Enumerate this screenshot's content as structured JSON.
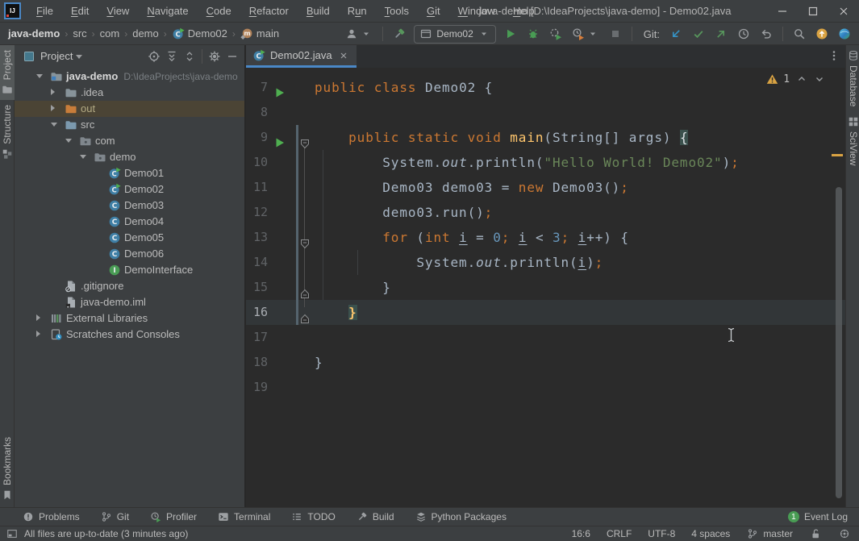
{
  "window": {
    "title": "java-demo [D:\\IdeaProjects\\java-demo] - Demo02.java",
    "menus": [
      {
        "label": "File",
        "mnemonic": 0
      },
      {
        "label": "Edit",
        "mnemonic": 0
      },
      {
        "label": "View",
        "mnemonic": 0
      },
      {
        "label": "Navigate",
        "mnemonic": 0
      },
      {
        "label": "Code",
        "mnemonic": 0
      },
      {
        "label": "Refactor",
        "mnemonic": 0
      },
      {
        "label": "Build",
        "mnemonic": 0
      },
      {
        "label": "Run",
        "mnemonic": 1
      },
      {
        "label": "Tools",
        "mnemonic": 0
      },
      {
        "label": "Git",
        "mnemonic": 0
      },
      {
        "label": "Window",
        "mnemonic": 0
      },
      {
        "label": "Help",
        "mnemonic": 0
      }
    ]
  },
  "navbar": {
    "breadcrumbs": [
      {
        "label": "java-demo",
        "bold": true
      },
      {
        "label": "src"
      },
      {
        "label": "com"
      },
      {
        "label": "demo"
      },
      {
        "label": "Demo02",
        "icon": "class-run-icon"
      },
      {
        "label": "main",
        "icon": "method-icon"
      }
    ],
    "toolbar": {
      "run_config": "Demo02",
      "git_label": "Git:",
      "left_icons": [
        "user-icon",
        "build-hammer-icon"
      ],
      "run_icons": [
        "run-icon",
        "debug-icon",
        "coverage-icon",
        "profiler-run-icon",
        "stop-icon"
      ],
      "git_icons": [
        "update-project-icon",
        "commit-icon",
        "push-icon",
        "history-icon",
        "rollback-icon"
      ],
      "right_icons": [
        "search-everywhere-icon",
        "updates-icon",
        "toolbox-icon"
      ]
    }
  },
  "left_stripe": {
    "top": [
      {
        "label": "Project",
        "icon": "project-tab-icon",
        "active": true
      },
      {
        "label": "Structure",
        "icon": "structure-tab-icon",
        "active": false
      }
    ],
    "bottom": [
      {
        "label": "Bookmarks",
        "icon": "bookmarks-tab-icon",
        "active": false
      }
    ]
  },
  "right_stripe": [
    {
      "label": "Database",
      "icon": "database-tab-icon"
    },
    {
      "label": "SciView",
      "icon": "grid-tab-icon"
    }
  ],
  "project": {
    "header": {
      "title": "Project",
      "icons": [
        "locate-icon",
        "expand-all-icon",
        "collapse-all-icon",
        "settings-icon",
        "hide-icon"
      ]
    },
    "tree": [
      {
        "label": "java-demo",
        "suffix": "D:\\IdeaProjects\\java-demo",
        "icon": "project-folder-icon",
        "depth": 0,
        "chevron": "down",
        "bold": true
      },
      {
        "label": ".idea",
        "icon": "folder-icon",
        "depth": 1,
        "chevron": "right"
      },
      {
        "label": "out",
        "icon": "folder-excluded-icon",
        "depth": 1,
        "chevron": "right",
        "selected": true
      },
      {
        "label": "src",
        "icon": "folder-src-icon",
        "depth": 1,
        "chevron": "down"
      },
      {
        "label": "com",
        "icon": "package-icon",
        "depth": 2,
        "chevron": "down"
      },
      {
        "label": "demo",
        "icon": "package-icon",
        "depth": 3,
        "chevron": "down"
      },
      {
        "label": "Demo01",
        "icon": "class-run-icon",
        "depth": 4
      },
      {
        "label": "Demo02",
        "icon": "class-run-icon",
        "depth": 4
      },
      {
        "label": "Demo03",
        "icon": "class-icon",
        "depth": 4
      },
      {
        "label": "Demo04",
        "icon": "class-icon",
        "depth": 4
      },
      {
        "label": "Demo05",
        "icon": "class-icon",
        "depth": 4
      },
      {
        "label": "Demo06",
        "icon": "class-icon",
        "depth": 4
      },
      {
        "label": "DemoInterface",
        "icon": "interface-icon",
        "depth": 4
      },
      {
        "label": ".gitignore",
        "icon": "file-ignored-icon",
        "depth": 1
      },
      {
        "label": "java-demo.iml",
        "icon": "file-iml-icon",
        "depth": 1
      },
      {
        "label": "External Libraries",
        "icon": "libraries-icon",
        "depth": 0,
        "chevron": "right"
      },
      {
        "label": "Scratches and Consoles",
        "icon": "scratches-icon",
        "depth": 0,
        "chevron": "right"
      }
    ]
  },
  "editor": {
    "tab": {
      "label": "Demo02.java",
      "icon": "class-run-icon"
    },
    "inspections": {
      "warning_count": "1"
    },
    "caret_line": 16,
    "run_lines": [
      7,
      9
    ],
    "folds": {
      "9": "down",
      "13": "down",
      "15": "up",
      "16": "up"
    },
    "lines": [
      {
        "num": 7,
        "tokens": [
          [
            "kw",
            "public class "
          ],
          [
            "pl",
            "Demo02 {"
          ]
        ]
      },
      {
        "num": 8,
        "tokens": []
      },
      {
        "num": 9,
        "tokens": [
          [
            "kw",
            "    public static void "
          ],
          [
            "fn",
            "main"
          ],
          [
            "pl",
            "(String[] args) "
          ],
          [
            "brl",
            "{"
          ]
        ]
      },
      {
        "num": 10,
        "tokens": [
          [
            "pl",
            "        System."
          ],
          [
            "fld",
            "out"
          ],
          [
            "pl",
            ".println("
          ],
          [
            "str",
            "\"Hello World! Demo02\""
          ],
          [
            "pl",
            ")"
          ],
          [
            "semi",
            ";"
          ]
        ]
      },
      {
        "num": 11,
        "tokens": [
          [
            "pl",
            "        Demo03 demo03 = "
          ],
          [
            "kw",
            "new "
          ],
          [
            "pl",
            "Demo03()"
          ],
          [
            "semi",
            ";"
          ]
        ]
      },
      {
        "num": 12,
        "tokens": [
          [
            "pl",
            "        demo03.run()"
          ],
          [
            "semi",
            ";"
          ]
        ]
      },
      {
        "num": 13,
        "tokens": [
          [
            "kw",
            "        for "
          ],
          [
            "pl",
            "("
          ],
          [
            "kw",
            "int "
          ],
          [
            "var",
            "i"
          ],
          [
            "pl",
            " = "
          ],
          [
            "num",
            "0"
          ],
          [
            "semi",
            "; "
          ],
          [
            "var",
            "i"
          ],
          [
            "pl",
            " < "
          ],
          [
            "num",
            "3"
          ],
          [
            "semi",
            "; "
          ],
          [
            "var",
            "i"
          ],
          [
            "pl",
            "++) {"
          ]
        ]
      },
      {
        "num": 14,
        "tokens": [
          [
            "pl",
            "            System."
          ],
          [
            "fld",
            "out"
          ],
          [
            "pl",
            ".println("
          ],
          [
            "var",
            "i"
          ],
          [
            "pl",
            ")"
          ],
          [
            "semi",
            ";"
          ]
        ]
      },
      {
        "num": 15,
        "tokens": [
          [
            "pl",
            "        }"
          ]
        ]
      },
      {
        "num": 16,
        "tokens": [
          [
            "pl",
            "    "
          ],
          [
            "brr",
            "}"
          ]
        ]
      },
      {
        "num": 17,
        "tokens": []
      },
      {
        "num": 18,
        "tokens": [
          [
            "pl",
            "}"
          ]
        ]
      },
      {
        "num": 19,
        "tokens": []
      }
    ]
  },
  "bottom_bar": {
    "items": [
      {
        "label": "Problems",
        "icon": "problems-icon"
      },
      {
        "label": "Git",
        "icon": "git-branch-icon"
      },
      {
        "label": "Profiler",
        "icon": "profiler-icon"
      },
      {
        "label": "Terminal",
        "icon": "terminal-icon"
      },
      {
        "label": "TODO",
        "icon": "todo-icon"
      },
      {
        "label": "Build",
        "icon": "build-icon"
      },
      {
        "label": "Python Packages",
        "icon": "packages-icon"
      }
    ],
    "event_log": {
      "label": "Event Log",
      "badge": "1"
    }
  },
  "status_bar": {
    "message": "All files are up-to-date (3 minutes ago)",
    "items": [
      {
        "label": "16:6"
      },
      {
        "label": "CRLF"
      },
      {
        "label": "UTF-8"
      },
      {
        "label": "4 spaces"
      },
      {
        "label": "master",
        "icon": "git-branch-icon"
      }
    ],
    "icons": [
      "unlock-icon",
      "highlight-level-icon"
    ]
  },
  "colors": {
    "accent": "#4a88c7",
    "keyword": "#cc7832",
    "string": "#6a8759",
    "number": "#6897bb",
    "function": "#ffc66d",
    "warning": "#d9a343",
    "run_green": "#499c54",
    "editor_bg": "#2b2b2b",
    "panel_bg": "#3c3f41"
  }
}
